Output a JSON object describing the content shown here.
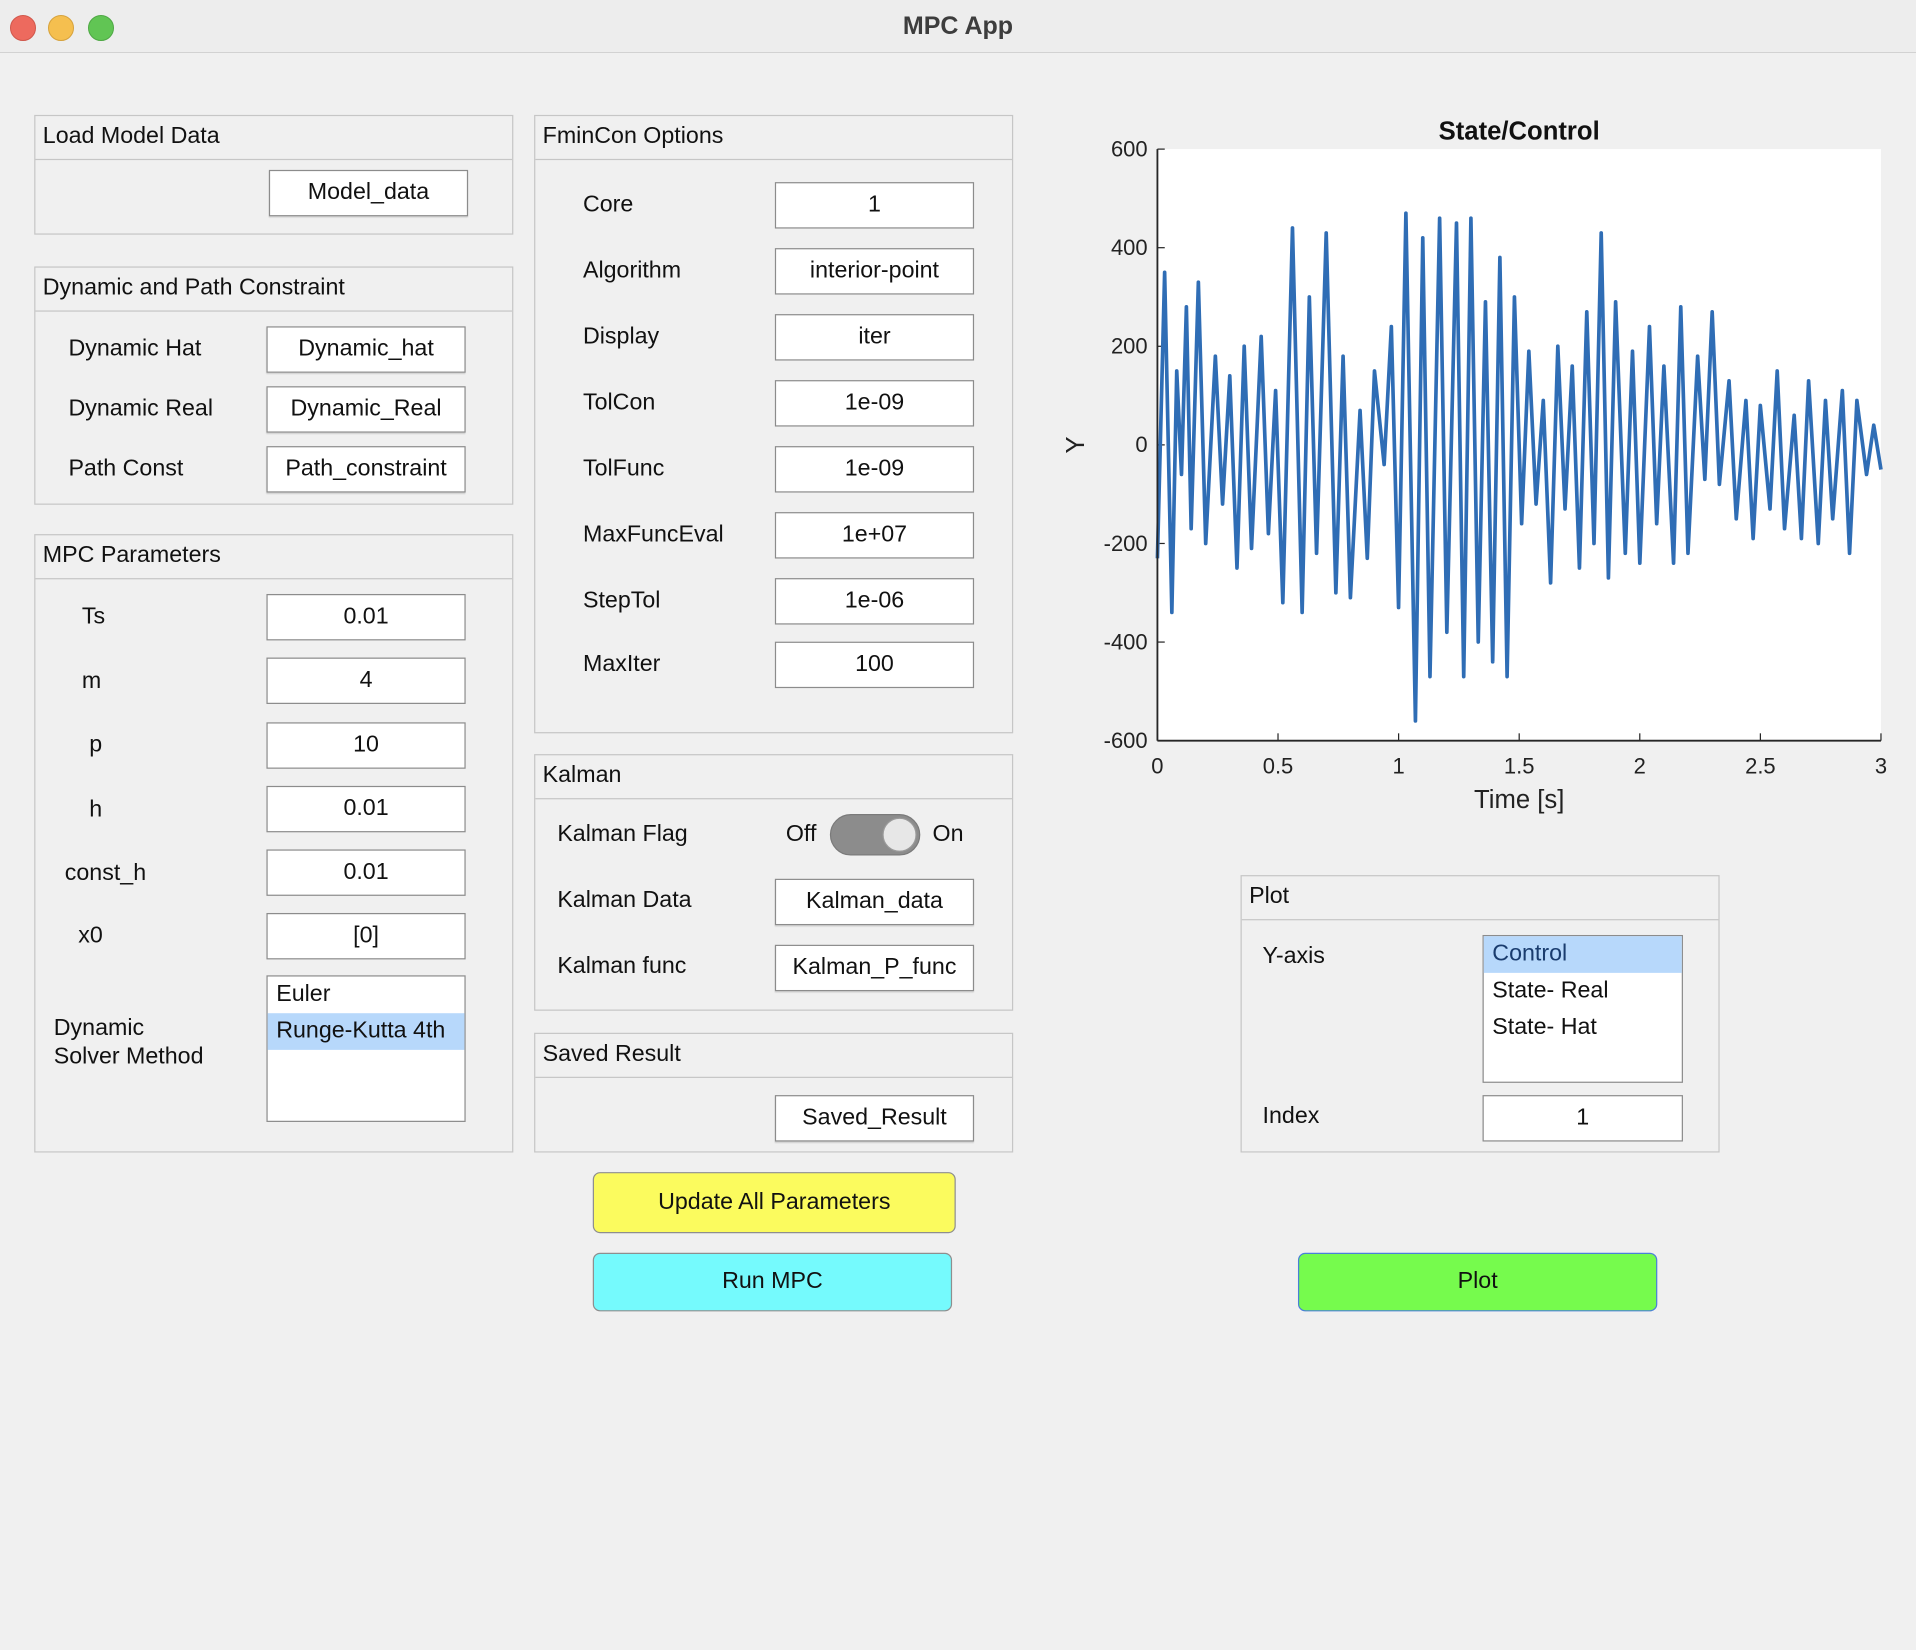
{
  "window": {
    "title": "MPC App"
  },
  "load_model": {
    "title": "Load Model Data",
    "button": "Model_data"
  },
  "dynamic_constraint": {
    "title": "Dynamic and Path Constraint",
    "rows": [
      {
        "label": "Dynamic Hat",
        "value": "Dynamic_hat"
      },
      {
        "label": "Dynamic Real",
        "value": "Dynamic_Real"
      },
      {
        "label": "Path Const",
        "value": "Path_constraint"
      }
    ]
  },
  "mpc_params": {
    "title": "MPC Parameters",
    "rows": [
      {
        "label": "Ts",
        "value": "0.01"
      },
      {
        "label": "m",
        "value": "4"
      },
      {
        "label": "p",
        "value": "10"
      },
      {
        "label": "h",
        "value": "0.01"
      },
      {
        "label": "const_h",
        "value": "0.01"
      },
      {
        "label": "x0",
        "value": "[0]"
      }
    ],
    "solver_label_1": "Dynamic",
    "solver_label_2": "Solver Method",
    "solver_options": [
      "Euler",
      "Runge-Kutta 4th"
    ],
    "solver_selected": "Runge-Kutta 4th"
  },
  "fmincon": {
    "title": "FminCon Options",
    "rows": [
      {
        "label": "Core",
        "value": "1"
      },
      {
        "label": "Algorithm",
        "value": "interior-point"
      },
      {
        "label": "Display",
        "value": "iter"
      },
      {
        "label": "TolCon",
        "value": "1e-09"
      },
      {
        "label": "TolFunc",
        "value": "1e-09"
      },
      {
        "label": "MaxFuncEval",
        "value": "1e+07"
      },
      {
        "label": "StepTol",
        "value": "1e-06"
      },
      {
        "label": "MaxIter",
        "value": "100"
      }
    ]
  },
  "kalman": {
    "title": "Kalman",
    "flag_label": "Kalman Flag",
    "switch_off": "Off",
    "switch_on": "On",
    "switch_state": "Off",
    "data_label": "Kalman Data",
    "data_value": "Kalman_data",
    "func_label": "Kalman func",
    "func_value": "Kalman_P_func"
  },
  "saved_result": {
    "title": "Saved Result",
    "button": "Saved_Result"
  },
  "buttons": {
    "update": "Update All Parameters",
    "run": "Run MPC",
    "plot": "Plot"
  },
  "colors": {
    "update_bg": "#fbfb5e",
    "run_bg": "#75fafd",
    "plot_bg": "#76fb4d",
    "line": "#2f6db5",
    "selection": "#b7d8fb"
  },
  "plot_panel": {
    "title": "Plot",
    "yaxis_label": "Y-axis",
    "yaxis_options": [
      "Control",
      "State- Real",
      "State- Hat"
    ],
    "yaxis_selected": "Control",
    "index_label": "Index",
    "index_value": "1"
  },
  "chart_data": {
    "type": "line",
    "title": "State/Control",
    "xlabel": "Time [s]",
    "ylabel": "Y",
    "xlim": [
      0,
      3
    ],
    "ylim": [
      -600,
      600
    ],
    "xticks": [
      "0",
      "0.5",
      "1",
      "1.5",
      "2",
      "2.5",
      "3"
    ],
    "yticks": [
      "600",
      "400",
      "200",
      "0",
      "-200",
      "-400",
      "-600"
    ],
    "grid": false,
    "series": [
      {
        "x": [
          0,
          0.03,
          0.06,
          0.08,
          0.1,
          0.12,
          0.14,
          0.17,
          0.2,
          0.24,
          0.27,
          0.3,
          0.33,
          0.36,
          0.39,
          0.43,
          0.46,
          0.49,
          0.52,
          0.56,
          0.6,
          0.63,
          0.66,
          0.7,
          0.74,
          0.77,
          0.8,
          0.84,
          0.87,
          0.9,
          0.94,
          0.97,
          1.0,
          1.03,
          1.07,
          1.1,
          1.13,
          1.17,
          1.2,
          1.24,
          1.27,
          1.3,
          1.33,
          1.36,
          1.39,
          1.42,
          1.45,
          1.48,
          1.51,
          1.54,
          1.57,
          1.6,
          1.63,
          1.66,
          1.69,
          1.72,
          1.75,
          1.78,
          1.81,
          1.84,
          1.87,
          1.9,
          1.94,
          1.97,
          2.0,
          2.04,
          2.07,
          2.1,
          2.14,
          2.17,
          2.2,
          2.24,
          2.27,
          2.3,
          2.33,
          2.37,
          2.4,
          2.44,
          2.47,
          2.5,
          2.54,
          2.57,
          2.6,
          2.64,
          2.67,
          2.7,
          2.74,
          2.77,
          2.8,
          2.84,
          2.87,
          2.9,
          2.94,
          2.97,
          3.0
        ],
        "y": [
          -230,
          350,
          -340,
          150,
          -60,
          280,
          -170,
          330,
          -200,
          180,
          -120,
          140,
          -250,
          200,
          -210,
          220,
          -180,
          110,
          -320,
          440,
          -340,
          300,
          -220,
          430,
          -300,
          180,
          -310,
          70,
          -230,
          150,
          -40,
          240,
          -330,
          470,
          -560,
          420,
          -470,
          460,
          -380,
          450,
          -470,
          460,
          -400,
          290,
          -440,
          380,
          -470,
          300,
          -160,
          190,
          -120,
          90,
          -280,
          200,
          -130,
          160,
          -250,
          270,
          -200,
          430,
          -270,
          290,
          -220,
          190,
          -240,
          240,
          -160,
          160,
          -240,
          280,
          -220,
          180,
          -70,
          270,
          -80,
          130,
          -150,
          90,
          -190,
          80,
          -130,
          150,
          -170,
          60,
          -190,
          130,
          -200,
          90,
          -150,
          110,
          -220,
          90,
          -60,
          40,
          -50
        ]
      }
    ]
  }
}
